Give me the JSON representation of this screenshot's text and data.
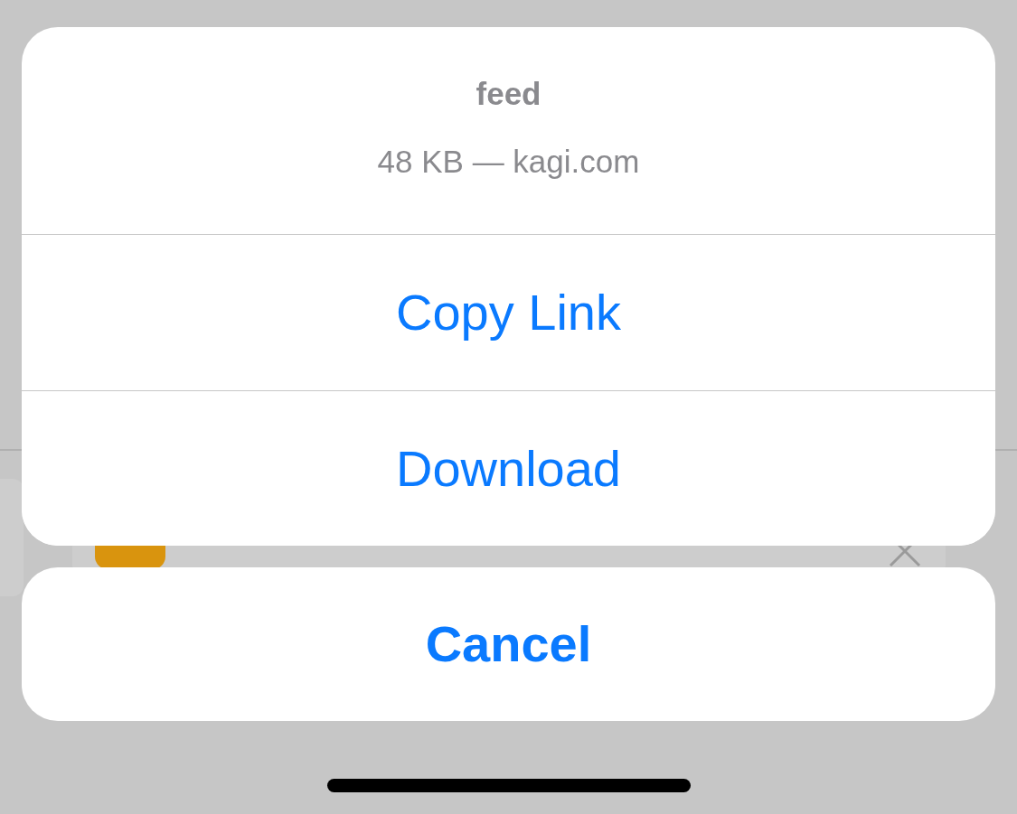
{
  "sheet": {
    "title": "feed",
    "subtitle": "48 KB — kagi.com",
    "actions": [
      {
        "label": "Copy Link"
      },
      {
        "label": "Download"
      }
    ]
  },
  "cancel": {
    "label": "Cancel"
  }
}
